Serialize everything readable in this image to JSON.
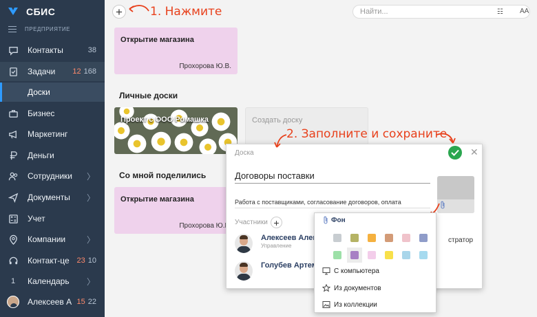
{
  "app": {
    "name": "СБИС",
    "company": "ПРЕДПРИЯТИЕ"
  },
  "sidebar": {
    "items": [
      {
        "label": "Контакты",
        "count": "38",
        "icon": "chat-icon"
      },
      {
        "label": "Задачи",
        "count_red": "12",
        "count": "168",
        "icon": "tasks-icon"
      },
      {
        "label": "Доски",
        "icon": ""
      },
      {
        "label": "Бизнес",
        "icon": "briefcase-icon"
      },
      {
        "label": "Маркетинг",
        "icon": "megaphone-icon"
      },
      {
        "label": "Деньги",
        "icon": "money-icon"
      },
      {
        "label": "Сотрудники",
        "chevron": "〉",
        "icon": "people-icon"
      },
      {
        "label": "Документы",
        "chevron": "〉",
        "icon": "send-icon"
      },
      {
        "label": "Учет",
        "icon": "calculator-icon"
      },
      {
        "label": "Компании",
        "chevron": "〉",
        "icon": "pin-icon"
      },
      {
        "label": "Контакт-це",
        "count_red": "23",
        "count": "10",
        "icon": "headset-icon"
      },
      {
        "label": "Календарь",
        "day": "1",
        "chevron": "〉",
        "icon": "calendar-icon"
      },
      {
        "label": "Алексеев А",
        "count_red": "15",
        "count": "22",
        "icon": "user-avatar"
      }
    ]
  },
  "top": {
    "add_symbol": "+",
    "annotation_1": "1. Нажмите",
    "search_placeholder": "Найти...",
    "list_icon": "☷",
    "font_icon": "AA"
  },
  "boards": {
    "card1": {
      "title": "Открытие магазина",
      "owner": "Прохорова Ю.В."
    },
    "personal_heading": "Личные доски",
    "card2": {
      "title": "Проект с ООО Ромашка"
    },
    "card3": {
      "title": "Создать доску"
    },
    "shared_heading": "Со мной поделились",
    "card4": {
      "title": "Открытие магазина",
      "owner": "Прохорова Ю.В."
    }
  },
  "annotation_2": "2. Заполните и сохраните",
  "dialog": {
    "label": "Доска",
    "close": "✕",
    "name": "Договоры поставки",
    "description": "Работа с поставщиками, согласование договоров, оплата",
    "participants_label": "Участники",
    "participants_add": "+",
    "people": [
      {
        "name": "Алексеев Алекс",
        "role": "Управление"
      },
      {
        "name": "Голубев Артем",
        "role": ""
      }
    ],
    "truncated_role": "стратор"
  },
  "popup": {
    "title": "Фон",
    "colors": [
      [
        "#c8cdd1",
        "#b5b365",
        "#f5b13f",
        "#d39b77",
        "#f0c3cb",
        "#8f9cc9"
      ],
      [
        "#9de0a8",
        "#a77fc4",
        "#f3cdea",
        "#f8e04a",
        "#a9d6ea",
        "#a6daef"
      ]
    ],
    "selected_color": "#a77fc4",
    "items": [
      {
        "label": "С компьютера",
        "icon": "monitor-icon"
      },
      {
        "label": "Из документов",
        "icon": "star-icon"
      },
      {
        "label": "Из коллекции",
        "icon": "image-icon"
      }
    ]
  },
  "colors": {
    "sidebar": "#2b3a4d",
    "accent": "#2e9bff",
    "annotation": "#e8411c",
    "ok": "#2aa64f",
    "pink_card": "#efd2ec"
  }
}
